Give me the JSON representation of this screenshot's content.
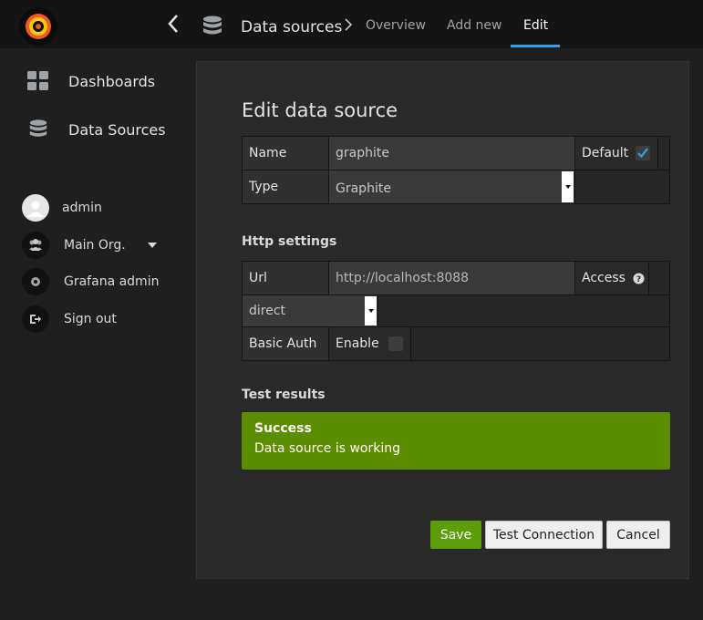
{
  "breadcrumb": {
    "title": "Data sources",
    "tabs": [
      "Overview",
      "Add new",
      "Edit"
    ]
  },
  "sidebar": {
    "items": [
      {
        "label": "Dashboards",
        "icon": "dashboards-grid-icon"
      },
      {
        "label": "Data Sources",
        "icon": "database-icon"
      }
    ],
    "user": {
      "name": "admin",
      "org": "Main Org.",
      "admin_link": "Grafana admin",
      "sign_out": "Sign out"
    }
  },
  "form": {
    "title": "Edit data source",
    "name_label": "Name",
    "name_value": "graphite",
    "default_label": "Default",
    "default_checked": true,
    "type_label": "Type",
    "type_value": "Graphite",
    "http_title": "Http settings",
    "url_label": "Url",
    "url_value": "http://localhost:8088",
    "access_label": "Access",
    "access_value": "direct",
    "basic_auth_label": "Basic Auth",
    "enable_label": "Enable",
    "basic_auth_checked": false
  },
  "test_results": {
    "title": "Test results",
    "status": "Success",
    "message": "Data source is working",
    "color": "#5c8d00"
  },
  "buttons": {
    "save": "Save",
    "test": "Test Connection",
    "cancel": "Cancel"
  },
  "colors": {
    "accent": "#33a2e5",
    "save": "#5c9d0a"
  }
}
